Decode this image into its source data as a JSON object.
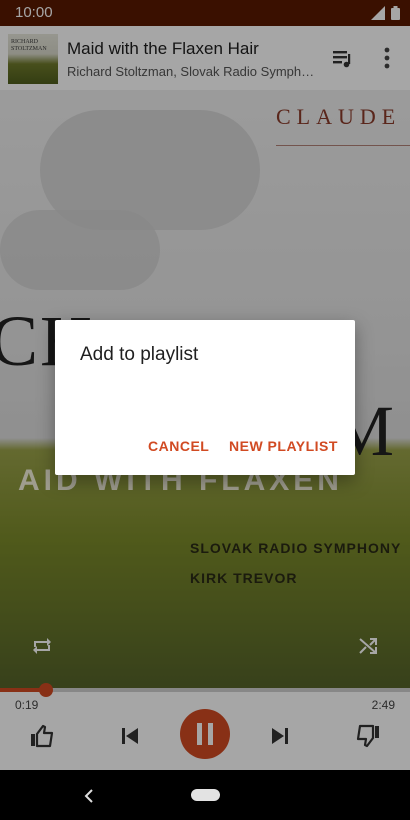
{
  "status_bar": {
    "time": "10:00"
  },
  "now_playing": {
    "title": "Maid with the Flaxen Hair",
    "artist": "Richard Stoltzman, Slovak Radio Symphony Orchestra"
  },
  "album_art": {
    "top_text": "CLAUDE",
    "big_left": "CH",
    "big_right": "M",
    "banner": "AID WITH FLAXEN",
    "orchestra": "SLOVAK RADIO SYMPHONY",
    "conductor": "KIRK TREVOR",
    "thumb_text": "RICHARD STOLTZMAN"
  },
  "playback": {
    "elapsed": "0:19",
    "total": "2:49",
    "progress_fraction": 0.112,
    "state": "playing"
  },
  "dialog": {
    "title": "Add to playlist",
    "cancel_label": "CANCEL",
    "new_playlist_label": "NEW PLAYLIST"
  },
  "colors": {
    "accent": "#d14a22",
    "status_bar": "#5a1a00"
  },
  "icons": [
    "signal-icon",
    "battery-icon",
    "queue-music-icon",
    "more-vert-icon",
    "repeat-icon",
    "shuffle-icon",
    "thumbs-up-icon",
    "skip-previous-icon",
    "pause-icon",
    "skip-next-icon",
    "thumbs-down-icon",
    "back-icon",
    "home-pill-icon"
  ]
}
